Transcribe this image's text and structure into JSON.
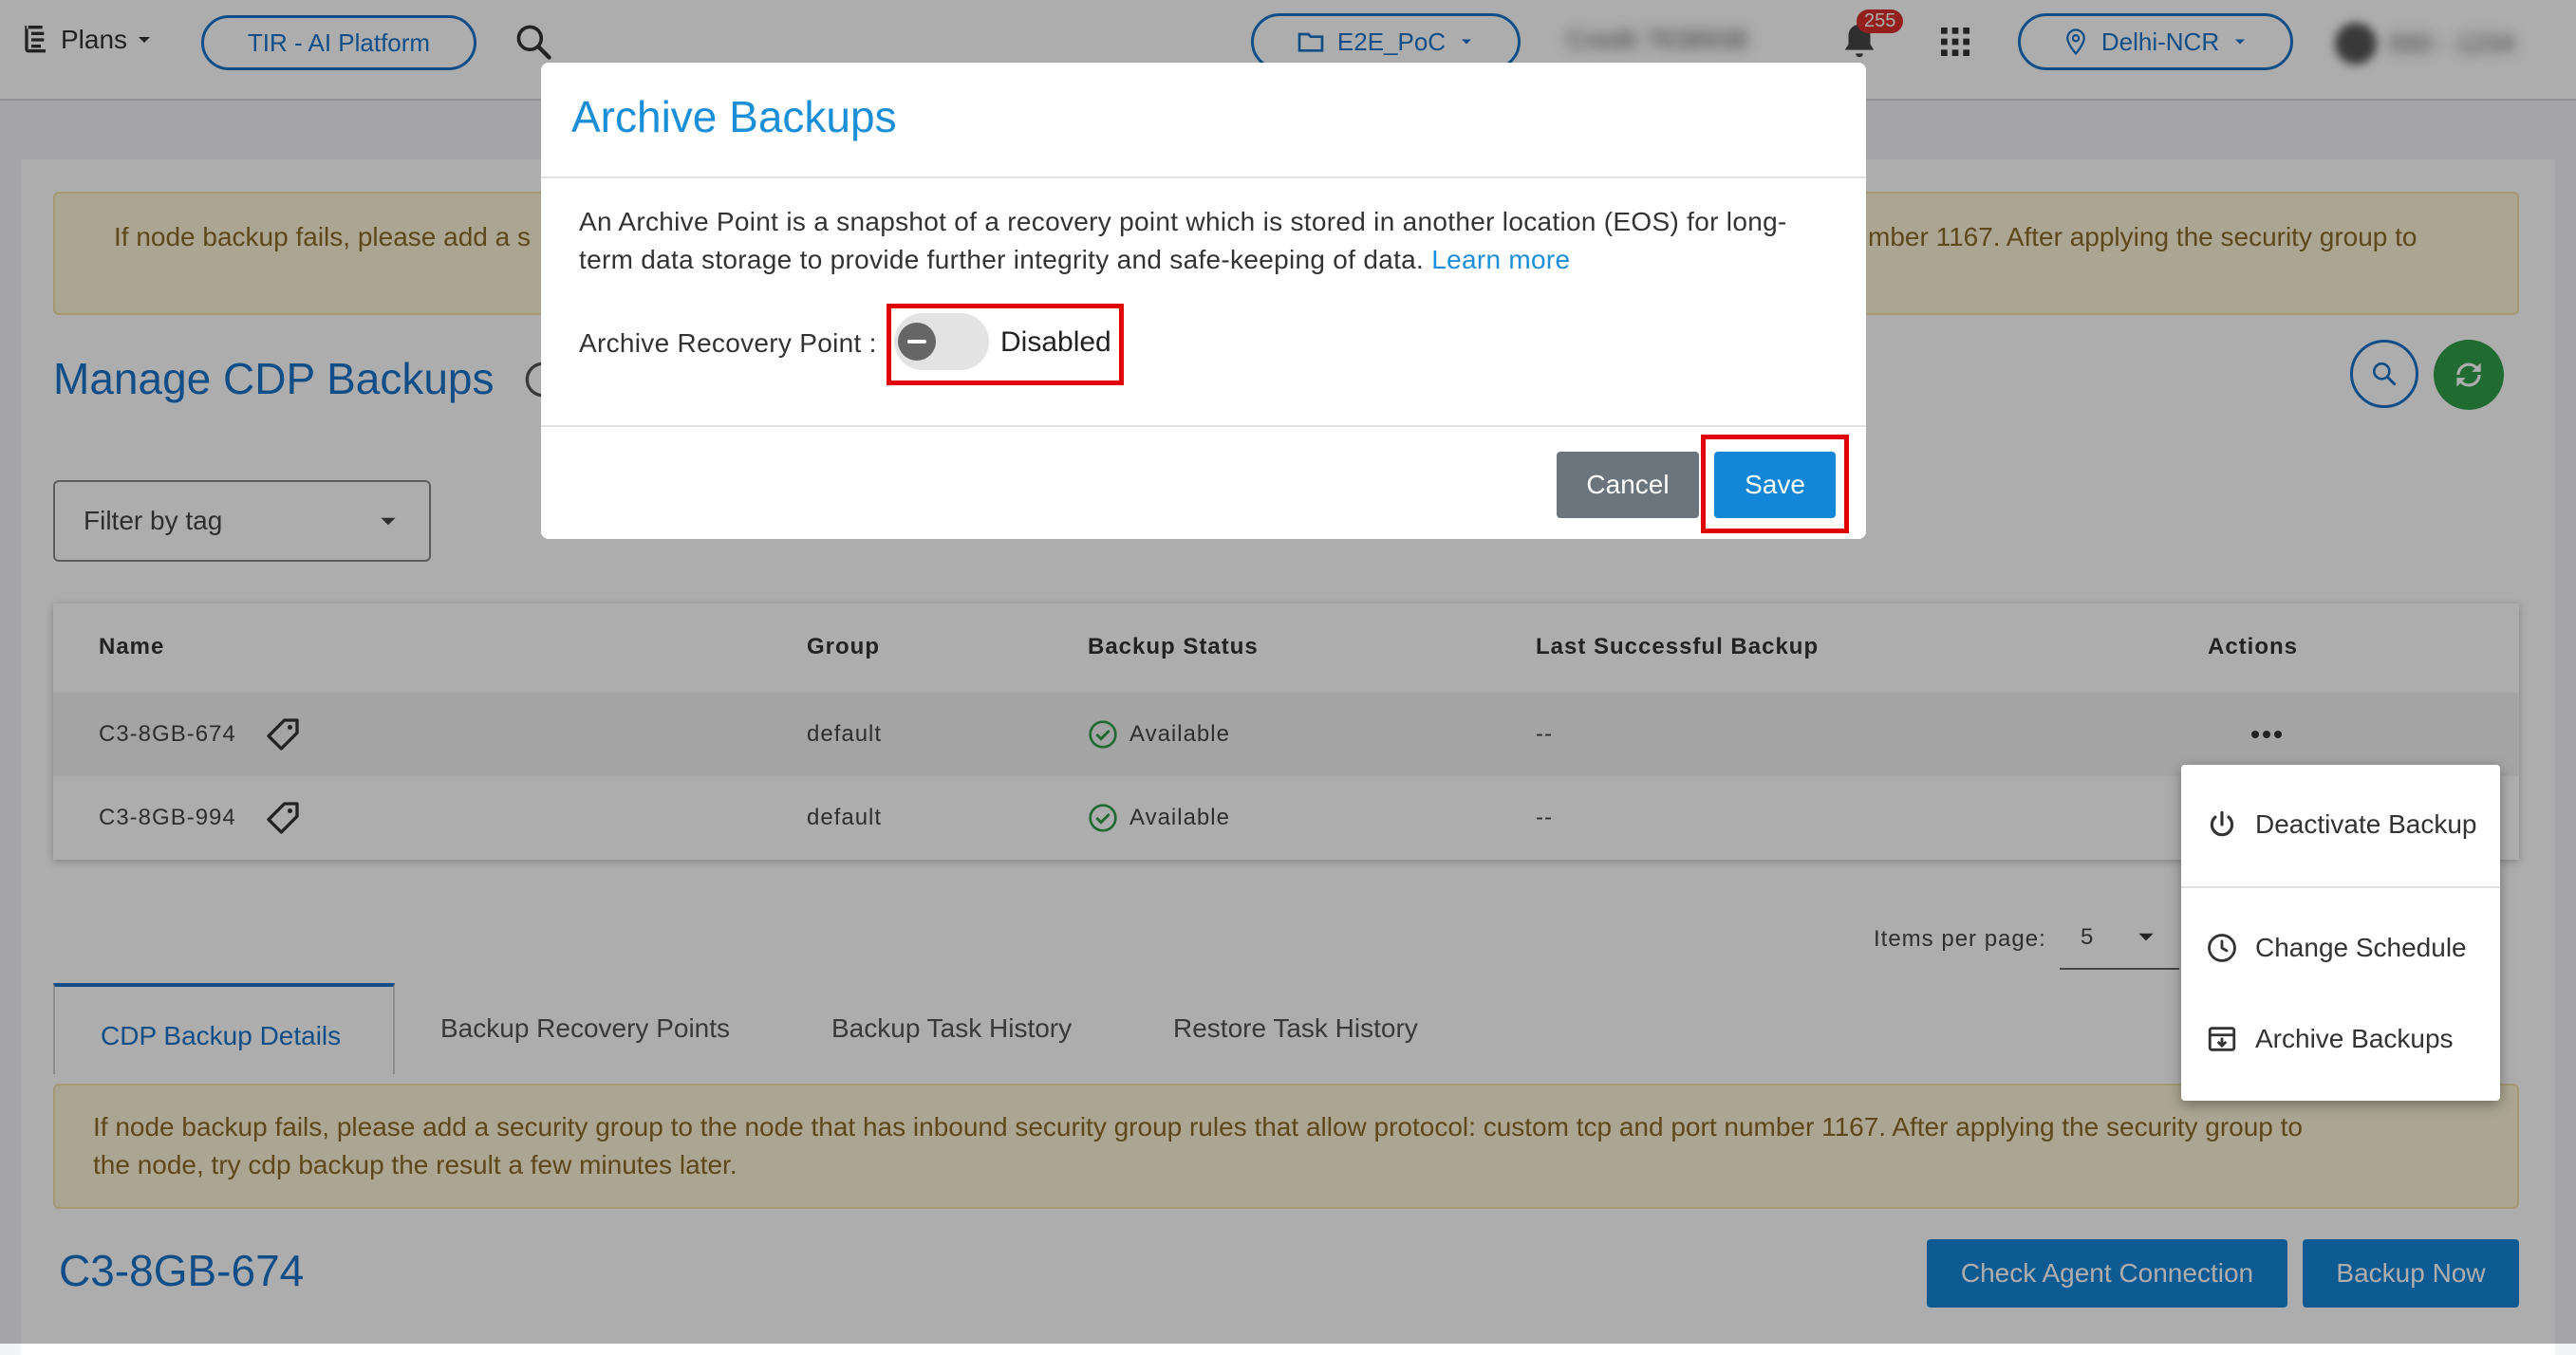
{
  "topbar": {
    "plans_label": "Plans",
    "platform_label": "TIR - AI Platform",
    "project_label": "E2E_PoC",
    "credit_label": "Credit 7638938",
    "notification_count": "255",
    "region_label": "Delhi-NCR",
    "account_label": "000 - 1234"
  },
  "page": {
    "warning_text": "If node backup fails, please add a security group to the node that has inbound security group rules that allow protocol: custom tcp and port number 1167. After applying the security group to the node, try cdp backup the result a few minutes later.",
    "warning_left": "If node backup fails, please add a s",
    "warning_right": "mber 1167. After applying the security group to",
    "title": "Manage CDP Backups",
    "filter_placeholder": "Filter by tag"
  },
  "table": {
    "headers": {
      "name": "Name",
      "group": "Group",
      "status": "Backup Status",
      "last": "Last Successful Backup",
      "actions": "Actions"
    },
    "rows": [
      {
        "name": "C3-8GB-674",
        "group": "default",
        "status": "Available",
        "last": "--"
      },
      {
        "name": "C3-8GB-994",
        "group": "default",
        "status": "Available",
        "last": "--"
      }
    ],
    "items_per_page_label": "Items per page:",
    "items_per_page_value": "5"
  },
  "actions_menu": {
    "deactivate": "Deactivate Backup",
    "change_schedule": "Change Schedule",
    "archive": "Archive Backups"
  },
  "tabs": [
    "CDP Backup Details",
    "Backup Recovery Points",
    "Backup Task History",
    "Restore Task History"
  ],
  "details": {
    "warning_line1": "If node backup fails, please add a security group to the node that has inbound security group rules that allow protocol: custom tcp and port number 1167. After applying the security group to",
    "warning_line2": "the node, try cdp backup the result a few minutes later.",
    "node_name": "C3-8GB-674",
    "check_agent_label": "Check Agent Connection",
    "backup_now_label": "Backup Now"
  },
  "modal": {
    "title": "Archive Backups",
    "description_line1": "An Archive Point is a snapshot of a recovery point which is stored in another location (EOS) for long-",
    "description_line2": "term data storage to provide further integrity and safe-keeping of data.",
    "learn_more": "Learn more",
    "field_label": "Archive Recovery Point :",
    "toggle_state": "Disabled",
    "cancel_label": "Cancel",
    "save_label": "Save"
  },
  "colors": {
    "accent": "#1a8fd8",
    "highlight": "#e00000",
    "success": "#2e9e4a",
    "badge": "#d9302c"
  }
}
